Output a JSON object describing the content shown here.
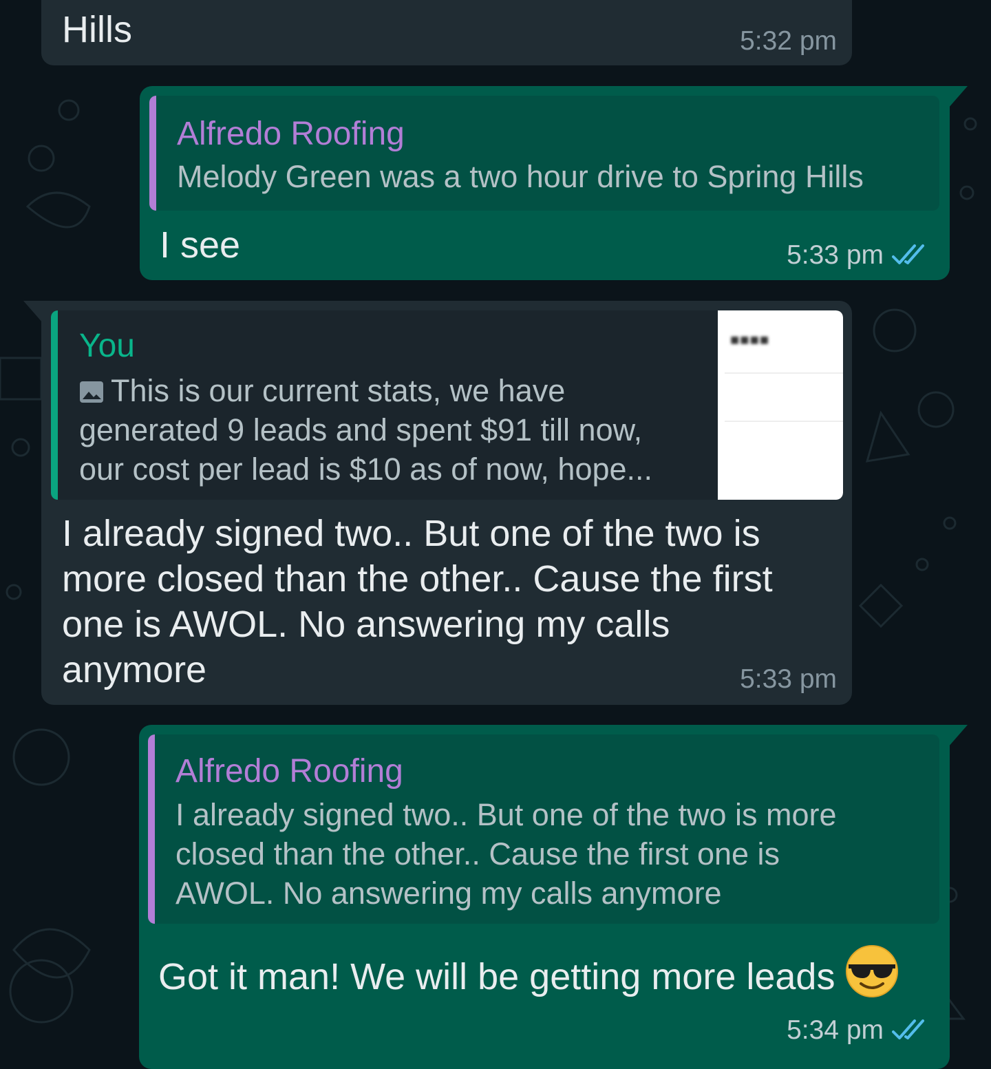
{
  "messages": [
    {
      "text": "Hills",
      "time": "5:32 pm"
    },
    {
      "quote": {
        "author": "Alfredo Roofing",
        "text": "Melody Green was a two hour drive to Spring Hills"
      },
      "text": "I see",
      "time": "5:33 pm",
      "status_icon": "double-check-read-icon"
    },
    {
      "quote": {
        "author": "You",
        "line1": "This is our current stats, we have",
        "line2": "generated 9 leads and spent $91 till now,",
        "line3": "our cost per lead is $10 as of now, hope...",
        "thumb_text": "■■■■"
      },
      "line1": "I already signed two.. But one of the two is",
      "line2": "more closed than the other.. Cause the first",
      "line3": "one is AWOL. No answering my calls",
      "line4": "anymore",
      "time": "5:33 pm"
    },
    {
      "quote": {
        "author": "Alfredo Roofing",
        "line1": "I already signed two.. But one of the two is more",
        "line2": "closed than the other.. Cause the first one is",
        "line3": "AWOL. No answering my calls anymore"
      },
      "text": "Got it man! We will be getting more leads",
      "emoji": "smiling-face-with-sunglasses-icon",
      "time": "5:34 pm",
      "status_icon": "double-check-read-icon"
    }
  ],
  "colors": {
    "background": "#0b141a",
    "incoming_bubble": "#202c33",
    "outgoing_bubble": "#005c4b",
    "author_purple": "#b27ed6",
    "author_you_teal": "#06cf9c",
    "read_ticks_blue": "#53bdeb"
  }
}
